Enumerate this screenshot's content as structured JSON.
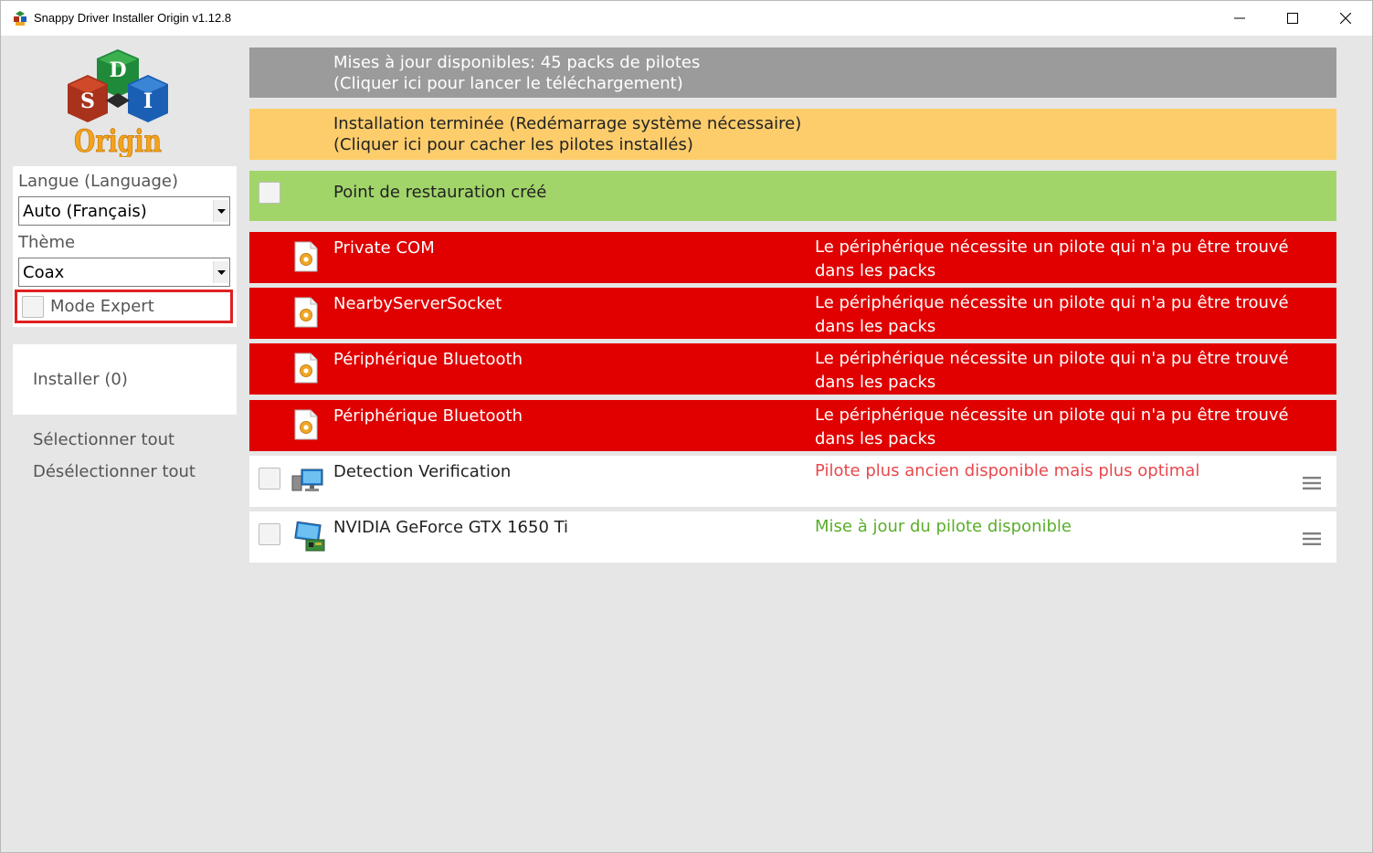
{
  "window": {
    "title": "Snappy Driver Installer Origin v1.12.8"
  },
  "logo": {
    "top": "D",
    "left": "S",
    "right": "I",
    "word": "Origin"
  },
  "settings": {
    "language_label": "Langue (Language)",
    "language_value": "Auto (Français)",
    "theme_label": "Thème",
    "theme_value": "Coax",
    "expert_label": "Mode Expert"
  },
  "actions": {
    "install_label": "Installer (0)",
    "select_all": "Sélectionner tout",
    "deselect_all": "Désélectionner tout"
  },
  "banners": {
    "updates_line1": "Mises à jour disponibles: 45 packs de pilotes",
    "updates_line2": "(Cliquer ici pour lancer le téléchargement)",
    "installed_line1": "Installation terminée (Redémarrage système nécessaire)",
    "installed_line2": "(Cliquer ici pour cacher les pilotes installés)",
    "restore_point": "Point de restauration créé"
  },
  "missing_drivers": [
    {
      "name": "Private COM",
      "status_line1": "Le périphérique nécessite un pilote qui n'a pu être trouvé",
      "status_line2": "dans les packs"
    },
    {
      "name": "NearbyServerSocket",
      "status_line1": "Le périphérique nécessite un pilote qui n'a pu être trouvé",
      "status_line2": "dans les packs"
    },
    {
      "name": "Périphérique Bluetooth",
      "status_line1": "Le périphérique nécessite un pilote qui n'a pu être trouvé",
      "status_line2": "dans les packs"
    },
    {
      "name": "Périphérique Bluetooth",
      "status_line1": "Le périphérique nécessite un pilote qui n'a pu être trouvé",
      "status_line2": "dans les packs"
    }
  ],
  "drivers": [
    {
      "name": "Detection Verification",
      "status": "Pilote plus ancien disponible mais plus optimal",
      "status_color": "#e8484d"
    },
    {
      "name": "NVIDIA GeForce GTX 1650 Ti",
      "status": "Mise à jour du pilote disponible",
      "status_color": "#5aae2a"
    }
  ],
  "colors": {
    "updates_bg": "#9b9b9b",
    "installed_bg": "#fdcd6c",
    "restore_bg": "#a2d569",
    "missing_bg": "#e00000"
  }
}
